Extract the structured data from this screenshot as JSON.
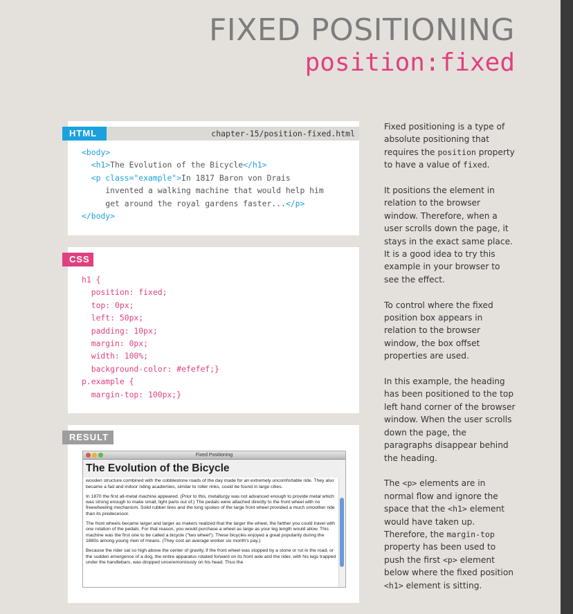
{
  "header": {
    "title": "FIXED POSITIONING",
    "subtitle": "position:fixed"
  },
  "html_panel": {
    "label": "HTML",
    "filename": "chapter-15/position-fixed.html",
    "code": {
      "line1_tag": "<body>",
      "line2_open": "<h1>",
      "line2_text": "The Evolution of the Bicycle",
      "line2_close": "</h1>",
      "line3_open": "<p ",
      "line3_attr": "class=\"example\"",
      "line3_end": ">",
      "line3_text": "In 1817 Baron von Drais",
      "line4_text": "invented a walking machine that would help him",
      "line5_text": "get around the royal gardens faster...",
      "line5_close": "</p>",
      "line6_tag": "</body>"
    }
  },
  "css_panel": {
    "label": "CSS",
    "code": [
      "h1 {",
      "  position: fixed;",
      "  top: 0px;",
      "  left: 50px;",
      "  padding: 10px;",
      "  margin: 0px;",
      "  width: 100%;",
      "  background-color: #efefef;}",
      "p.example {",
      "  margin-top: 100px;}"
    ]
  },
  "result_panel": {
    "label": "RESULT",
    "window_title": "Fixed Positioning",
    "heading": "The Evolution of the Bicycle",
    "paragraphs": [
      "the front wheel. This machine was known as the velocipede (meaning \"fast foot\") as well as the \"bone shaker,\" since it's wooden structure combined with the cobblestone roads of the day made for an extremely uncomfortable ride. They also became a fad and indoor riding academies, similar to roller rinks, could be found in large cities.",
      "In 1870 the first all-metal machine appeared. (Prior to this, metallurgy was not advanced enough to provide metal which was strong enough to make small, light parts out of.) The pedals were attached directly to the front wheel with no freewheeling mechanism. Solid rubber tires and the long spokes of the large front wheel provided a much smoother ride than its predecessor.",
      "The front wheels became larger and larger as makers realized that the larger the wheel, the farther you could travel with one rotation of the pedals. For that reason, you would purchase a wheel as large as your leg length would allow. This machine was the first one to be called a bicycle (\"two wheel\"). These bicycles enjoyed a great popularity during the 1880s among young men of means. (They cost an average worker six month's pay.)",
      "Because the rider sat so high above the center of gravity, if the front wheel was stopped by a stone or rut in the road, or the sudden emergence of a dog, the entire apparatus rotated forward on its front axle and the rider, with his legs trapped under the handlebars, was dropped unceremoniously on his head. Thus the"
    ]
  },
  "explanation": {
    "p1_a": "Fixed positioning is a type of absolute positioning that requires the ",
    "p1_code": "position",
    "p1_b": " property to have a value of ",
    "p1_code2": "fixed",
    "p1_c": ".",
    "p2": "It positions the element in relation to the browser window. Therefore, when a user scrolls down the page, it stays in the exact same place. It is a good idea to try this example in your browser to see the effect.",
    "p3": "To control where the fixed position box appears in relation to the browser window, the box offset properties are used.",
    "p4": "In this example, the heading has been positioned to the top left hand corner of the browser window. When the user scrolls down the page, the paragraphs disappear behind the heading.",
    "p5_a": "The ",
    "p5_code1": "<p>",
    "p5_b": " elements are in normal flow and ignore the space that the ",
    "p5_code2": "<h1>",
    "p5_c": " element would have taken up. Therefore, the ",
    "p5_code3": "margin-top",
    "p5_d": " property has been used to push the first ",
    "p5_code4": "<p>",
    "p5_e": " element below where the fixed position ",
    "p5_code5": "<h1>",
    "p5_f": " element is sitting."
  }
}
